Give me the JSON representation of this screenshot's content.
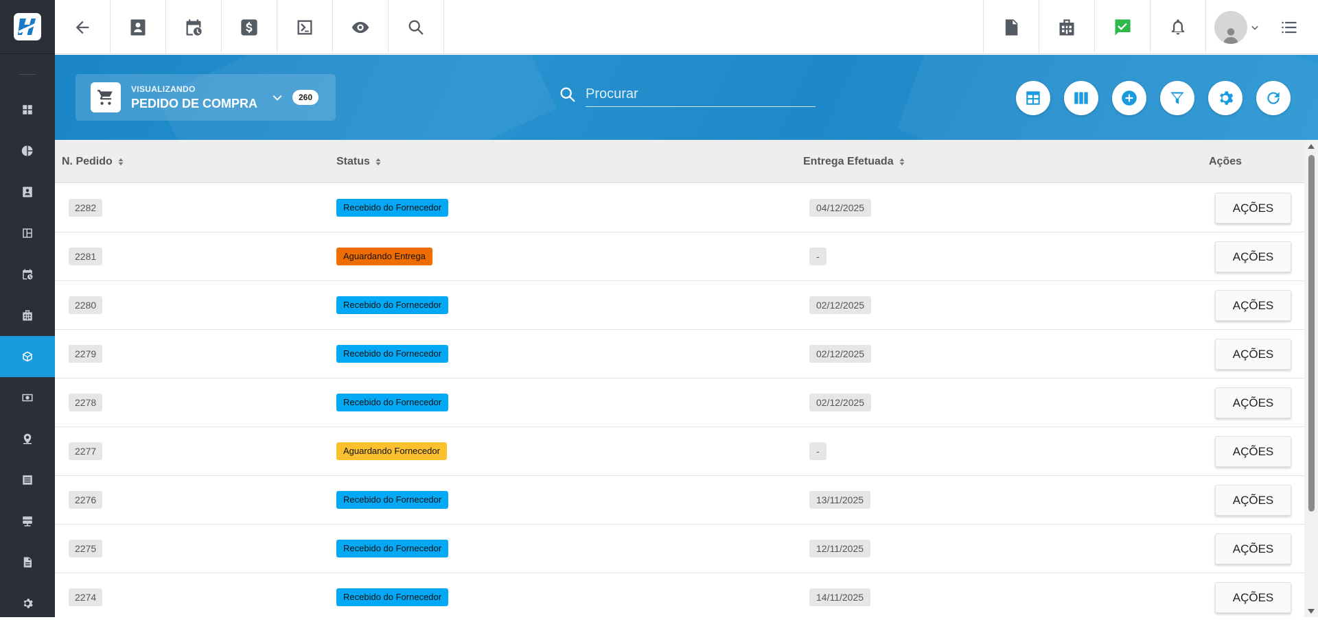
{
  "header": {
    "viewing_label": "VISUALIZANDO",
    "module_title": "PEDIDO DE COMPRA",
    "record_count": "260",
    "search_placeholder": "Procurar"
  },
  "table": {
    "columns": [
      "N. Pedido",
      "Status",
      "Entrega Efetuada",
      "Ações"
    ],
    "action_label": "AÇÕES",
    "rows": [
      {
        "number": "2282",
        "status": "Recebido do Fornecedor",
        "status_color": "#03a9f4",
        "delivery": "04/12/2025"
      },
      {
        "number": "2281",
        "status": "Aguardando Entrega",
        "status_color": "#ef6c00",
        "delivery": "-"
      },
      {
        "number": "2280",
        "status": "Recebido do Fornecedor",
        "status_color": "#03a9f4",
        "delivery": "02/12/2025"
      },
      {
        "number": "2279",
        "status": "Recebido do Fornecedor",
        "status_color": "#03a9f4",
        "delivery": "02/12/2025"
      },
      {
        "number": "2278",
        "status": "Recebido do Fornecedor",
        "status_color": "#03a9f4",
        "delivery": "02/12/2025"
      },
      {
        "number": "2277",
        "status": "Aguardando Fornecedor",
        "status_color": "#fbc02d",
        "delivery": "-"
      },
      {
        "number": "2276",
        "status": "Recebido do Fornecedor",
        "status_color": "#03a9f4",
        "delivery": "13/11/2025"
      },
      {
        "number": "2275",
        "status": "Recebido do Fornecedor",
        "status_color": "#03a9f4",
        "delivery": "12/11/2025"
      },
      {
        "number": "2274",
        "status": "Recebido do Fornecedor",
        "status_color": "#03a9f4",
        "delivery": "14/11/2025"
      }
    ]
  },
  "topbar_icons": [
    "back-arrow-icon",
    "contact-card-icon",
    "calendar-clock-icon",
    "dollar-icon",
    "terminal-icon",
    "eye-icon",
    "search-icon",
    "pdf-icon",
    "building-icon",
    "message-check-icon",
    "bell-icon",
    "avatar",
    "list-menu-icon"
  ],
  "sidebar_icons": [
    "dashboard-icon",
    "pie-chart-icon",
    "contacts-icon",
    "kanban-icon",
    "calendar-icon",
    "company-icon",
    "package-icon",
    "money-icon",
    "location-icon",
    "list-icon",
    "server-icon",
    "document-icon",
    "settings-icon"
  ],
  "hero_buttons": [
    "table-view-icon",
    "columns-icon",
    "add-icon",
    "filter-icon",
    "settings-icon",
    "refresh-icon"
  ],
  "colors": {
    "accent": "#1a9be0",
    "sidebar_bg": "#2b3038",
    "header_gradient": "#2792d0",
    "status_received": "#03a9f4",
    "status_waiting_delivery": "#ef6c00",
    "status_waiting_supplier": "#fbc02d",
    "notification_green": "#2eb84a"
  }
}
